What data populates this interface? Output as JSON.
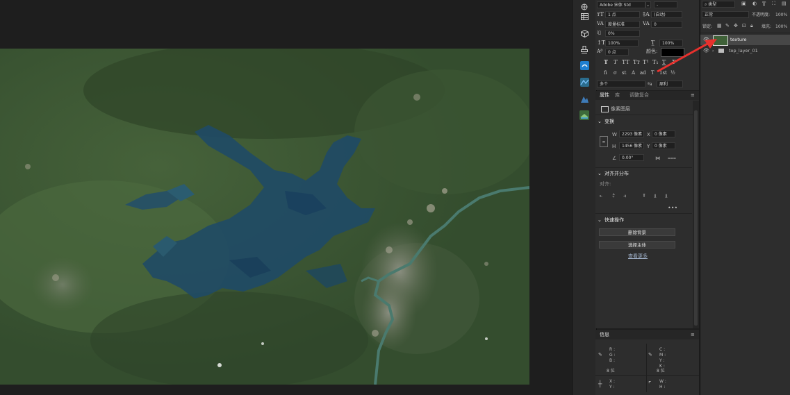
{
  "character": {
    "font_family": "Adobe 宋体 Std",
    "font_style": "-",
    "font_size": "1 点",
    "leading": "(自动)",
    "kerning": "度量标准",
    "tracking": "0",
    "tsume": "0%",
    "vertical_scale": "100%",
    "horizontal_scale": "100%",
    "baseline_shift": "0 点",
    "color_label": "颜色:",
    "language": "多个",
    "antialias_label": "ªa",
    "antialias": "犀利",
    "style_buttons": [
      "T",
      "T",
      "TT",
      "Tт",
      "T¹",
      "T₁",
      "T",
      "T"
    ],
    "opentype_buttons": [
      "fi",
      "σ",
      "st",
      "A",
      "ad",
      "T",
      "1st",
      "½"
    ],
    "text_color": "#000000"
  },
  "properties": {
    "tabs": [
      "属性",
      "库",
      "调整复合"
    ],
    "layer_type": "像素图层",
    "transform": {
      "title": "变换",
      "w_label": "W",
      "w": "2293 像素",
      "x_label": "X",
      "x": "0 像素",
      "h_label": "H",
      "h": "1456 像素",
      "y_label": "Y",
      "y": "0 像素",
      "angle": "0.00°"
    },
    "align": {
      "title": "对齐并分布",
      "label": "对齐:"
    },
    "quick_actions": {
      "title": "快速操作",
      "remove_bg": "删除背景",
      "select_subject": "选择主体",
      "more": "查看更多"
    }
  },
  "info": {
    "title": "信息",
    "rgb": [
      "R :",
      "G :",
      "B :"
    ],
    "cmyk": [
      "C :",
      "M :",
      "Y :",
      "K :"
    ],
    "bit_left": "8 位",
    "bit_right": "8 位",
    "xy": [
      "X :",
      "Y :"
    ],
    "wh": [
      "W :",
      "H :"
    ]
  },
  "layers": {
    "filter_kind": "类型",
    "blend_mode": "正常",
    "opacity_label": "不透明度:",
    "opacity": "100%",
    "lock_label": "锁定:",
    "fill_label": "填充:",
    "fill": "100%",
    "items": [
      {
        "name": "texture",
        "type": "pixel",
        "selected": true
      },
      {
        "name": "top_layer_01",
        "type": "group",
        "selected": false
      }
    ]
  },
  "annotation": {
    "arrow_color": "#e8312d"
  }
}
